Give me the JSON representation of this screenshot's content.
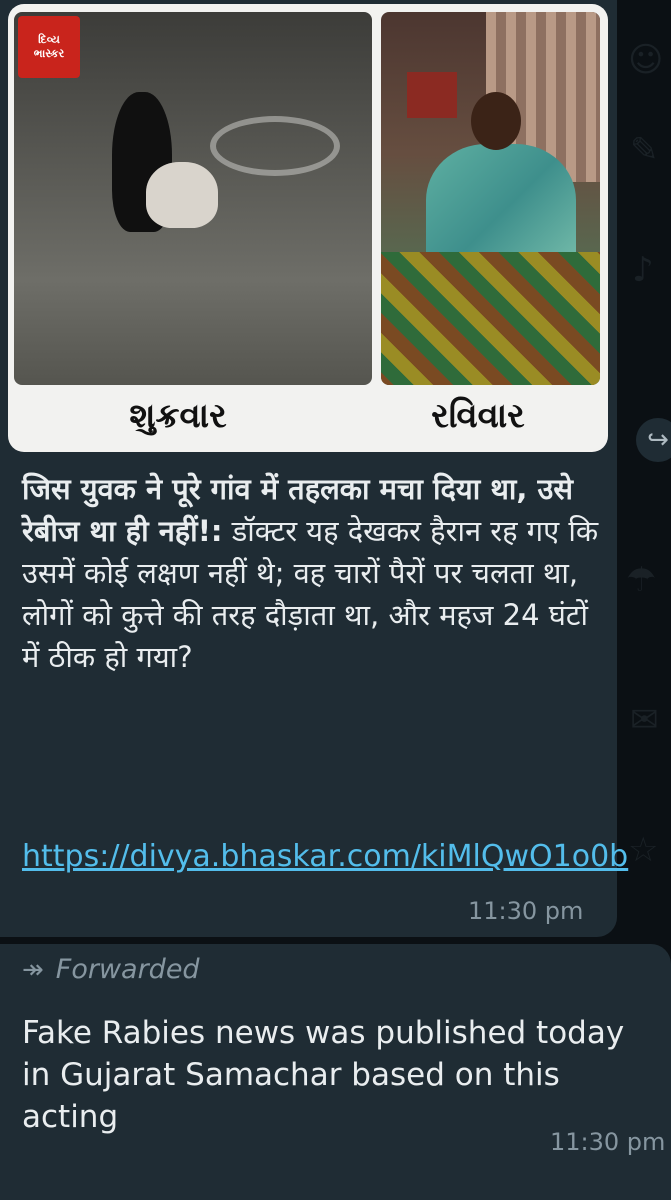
{
  "message1": {
    "image_caption_left": "શુક્રવાર",
    "image_caption_right": "રવિવાર",
    "logo_text_line1": "દિવ્ય",
    "logo_text_line2": "ભાસ્કર",
    "headline_bold": "जिस युवक ने पूरे गांव में तहलका मचा दिया था, उसे रेबीज था ही नहीं!:",
    "body_text": " डॉक्टर यह देखकर हैरान रह गए कि उसमें कोई लक्षण नहीं थे; वह चारों पैरों पर चलता था, लोगों को कुत्ते की तरह दौड़ाता था, और महज 24 घंटों में ठीक हो गया?",
    "link": "https://divya.bhaskar.com/kiMlQwO1o0b",
    "time": "11:30 pm"
  },
  "message2": {
    "forwarded_label": "Forwarded",
    "text": "Fake Rabies news was published today in Gujarat Samachar based on this acting",
    "time": "11:30 pm"
  },
  "colors": {
    "background": "#0b1014",
    "bubble": "#1f2c34",
    "text": "#e9edef",
    "link": "#53bdeb",
    "meta": "#8696a0"
  },
  "icons": {
    "forward_button": "share-forward-icon",
    "forwarded_marker": "forwarded-icon"
  }
}
